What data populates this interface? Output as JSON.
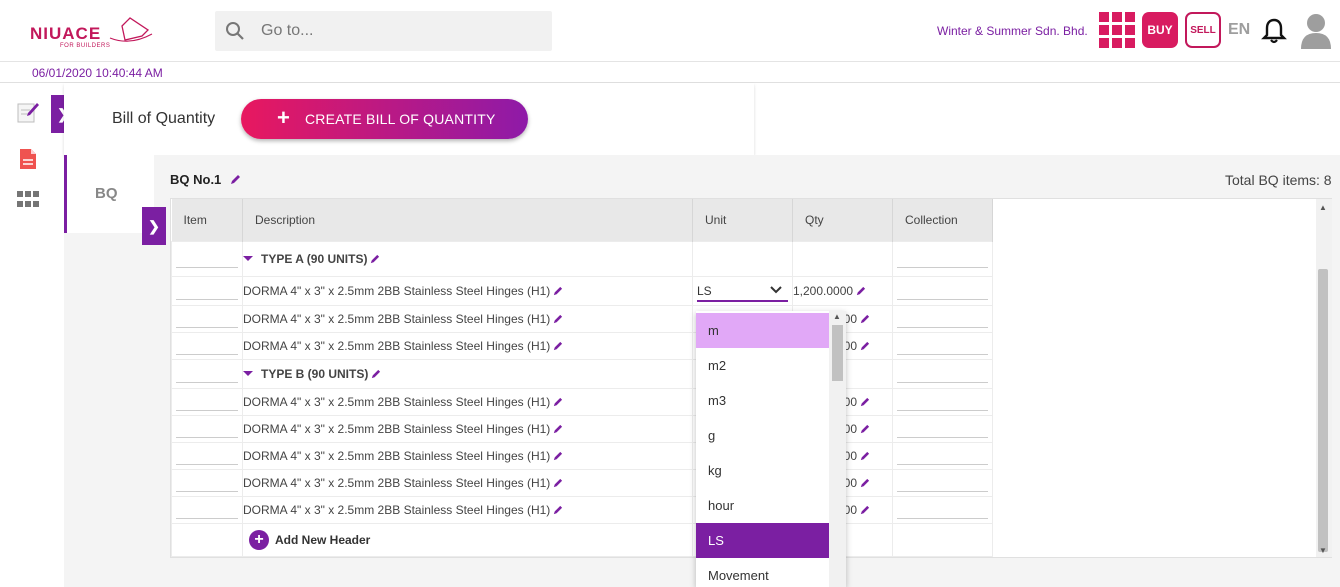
{
  "header": {
    "logo_text": "NIUACE",
    "logo_sub": "FOR BUILDERS",
    "search_placeholder": "Go to...",
    "company": "Winter & Summer Sdn. Bhd.",
    "buy_label": "BUY",
    "sell_label": "SELL",
    "language": "EN",
    "datetime": "06/01/2020 10:40:44 AM",
    "accent_color": "#7b1fa2",
    "brand_color": "#d81b60"
  },
  "page": {
    "title": "Bill of Quantity",
    "create_button": "CREATE BILL OF QUANTITY",
    "tab_label": "BQ"
  },
  "bq": {
    "title": "BQ No.1",
    "total_label": "Total BQ items: 8",
    "columns": [
      "Item",
      "Description",
      "Unit",
      "Qty",
      "Collection"
    ],
    "headers": [
      "TYPE A (90 UNITS)",
      "TYPE B (90 UNITS)"
    ],
    "rows": [
      {
        "description": "DORMA 4\" x 3\" x 2.5mm 2BB Stainless Steel Hinges (H1)",
        "unit": "LS",
        "qty": "1,200.0000"
      },
      {
        "description": "DORMA 4\" x 3\" x 2.5mm 2BB Stainless Steel Hinges (H1)",
        "qty_partial": "00"
      },
      {
        "description": "DORMA 4\" x 3\" x 2.5mm 2BB Stainless Steel Hinges (H1)",
        "qty_partial": "00"
      },
      {
        "description": "DORMA 4\" x 3\" x 2.5mm 2BB Stainless Steel Hinges (H1)",
        "qty_partial": "00"
      },
      {
        "description": "DORMA 4\" x 3\" x 2.5mm 2BB Stainless Steel Hinges (H1)",
        "qty_partial": "00"
      },
      {
        "description": "DORMA 4\" x 3\" x 2.5mm 2BB Stainless Steel Hinges (H1)",
        "qty_partial": "00"
      },
      {
        "description": "DORMA 4\" x 3\" x 2.5mm 2BB Stainless Steel Hinges (H1)",
        "qty_partial": "00"
      },
      {
        "description": "DORMA 4\" x 3\" x 2.5mm 2BB Stainless Steel Hinges (H1)",
        "qty_partial": "00"
      }
    ],
    "add_header": "Add New Header"
  },
  "unit_dropdown": {
    "options": [
      "m",
      "m2",
      "m3",
      "g",
      "kg",
      "hour",
      "LS",
      "Movement"
    ],
    "highlighted": "m",
    "selected": "LS"
  },
  "icons": {
    "search": "search-icon",
    "apps": "apps-grid-icon",
    "bell": "bell-icon",
    "avatar": "user-avatar-icon",
    "edit_nav": "edit-document-icon",
    "pdf_nav": "pdf-icon",
    "grid_nav": "grid-icon",
    "chevron": "chevron-right-icon",
    "pencil": "pencil-icon"
  }
}
